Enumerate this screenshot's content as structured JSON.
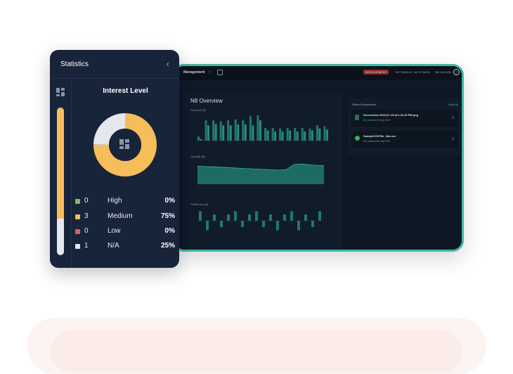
{
  "colors": {
    "accent": "#3fb8a0",
    "high": "#7dbf63",
    "medium": "#f6bd5b",
    "low": "#e25b5b",
    "na": "#e4e7ec",
    "chart_fill": "#1f7a68",
    "chart_stroke": "#33b296"
  },
  "stats": {
    "title": "Statistics",
    "back_icon": "chevron-left-icon",
    "side_icon": "dashboard-grid-icon",
    "interest_title": "Interest Level",
    "progress_fraction": 0.75,
    "levels": [
      {
        "count": "0",
        "name": "High",
        "pct": "0%",
        "fraction": 0,
        "color": "#7dbf63"
      },
      {
        "count": "3",
        "name": "Medium",
        "pct": "75%",
        "fraction": 0.75,
        "color": "#f6bd5b"
      },
      {
        "count": "0",
        "name": "Low",
        "pct": "0%",
        "fraction": 0,
        "color": "#e25b5b"
      },
      {
        "count": "1",
        "name": "N/A",
        "pct": "25%",
        "fraction": 0.25,
        "color": "#e4e7ec"
      }
    ]
  },
  "dashboard": {
    "tab_label": "Management",
    "tab_close": "×",
    "env_badge": "DEVELOPMENT",
    "topbar_items": [
      "NY: 03:04:01",
      "LN: 07:04:01",
      "HK: 14:04:01"
    ],
    "help_glyph": "?",
    "overview_title": "N8 Overview",
    "revenue_label": "Revenue ($)",
    "liquidity_label": "Liquidity ($)",
    "profit_label": "Profit/Loss ($)",
    "recent_docs_title": "Recent Documents",
    "view_all": "View All",
    "documents": [
      {
        "name": "Screenshot 2023-07-19 at 2.26.19 PM.png",
        "who": "Ext_stanne",
        "date": "19 July 2023",
        "icon_color": "#2c6a5c"
      },
      {
        "name": "SampleCSVFile_2kb.csv",
        "who": "Ext_stanne",
        "date": "06 July 2023",
        "icon_color": "#3cae5a"
      }
    ]
  },
  "chart_data": [
    {
      "type": "bar",
      "title": "Revenue ($)",
      "series": [
        {
          "values": [
            8,
            40,
            40,
            38,
            40,
            42,
            40,
            48,
            50,
            25,
            25,
            24,
            25,
            25,
            25,
            24,
            30,
            28
          ]
        },
        {
          "values": [
            3,
            30,
            33,
            30,
            30,
            32,
            32,
            30,
            40,
            20,
            18,
            18,
            20,
            18,
            18,
            20,
            24,
            22
          ]
        }
      ],
      "ylim": [
        0,
        50
      ]
    },
    {
      "type": "area",
      "title": "Liquidity ($)",
      "values": [
        100,
        98,
        97,
        95,
        93,
        90,
        88,
        86,
        84,
        82,
        80,
        78,
        82,
        110,
        112,
        108,
        105,
        103
      ],
      "ylim": [
        0,
        125
      ]
    },
    {
      "type": "bar",
      "title": "Profit/Loss ($)",
      "values": [
        3,
        -3,
        2,
        -2,
        2,
        3,
        -2,
        2,
        3,
        -2,
        2,
        -3,
        2,
        3,
        -3,
        2,
        -2,
        3
      ],
      "ylim": [
        -4,
        4
      ]
    }
  ]
}
